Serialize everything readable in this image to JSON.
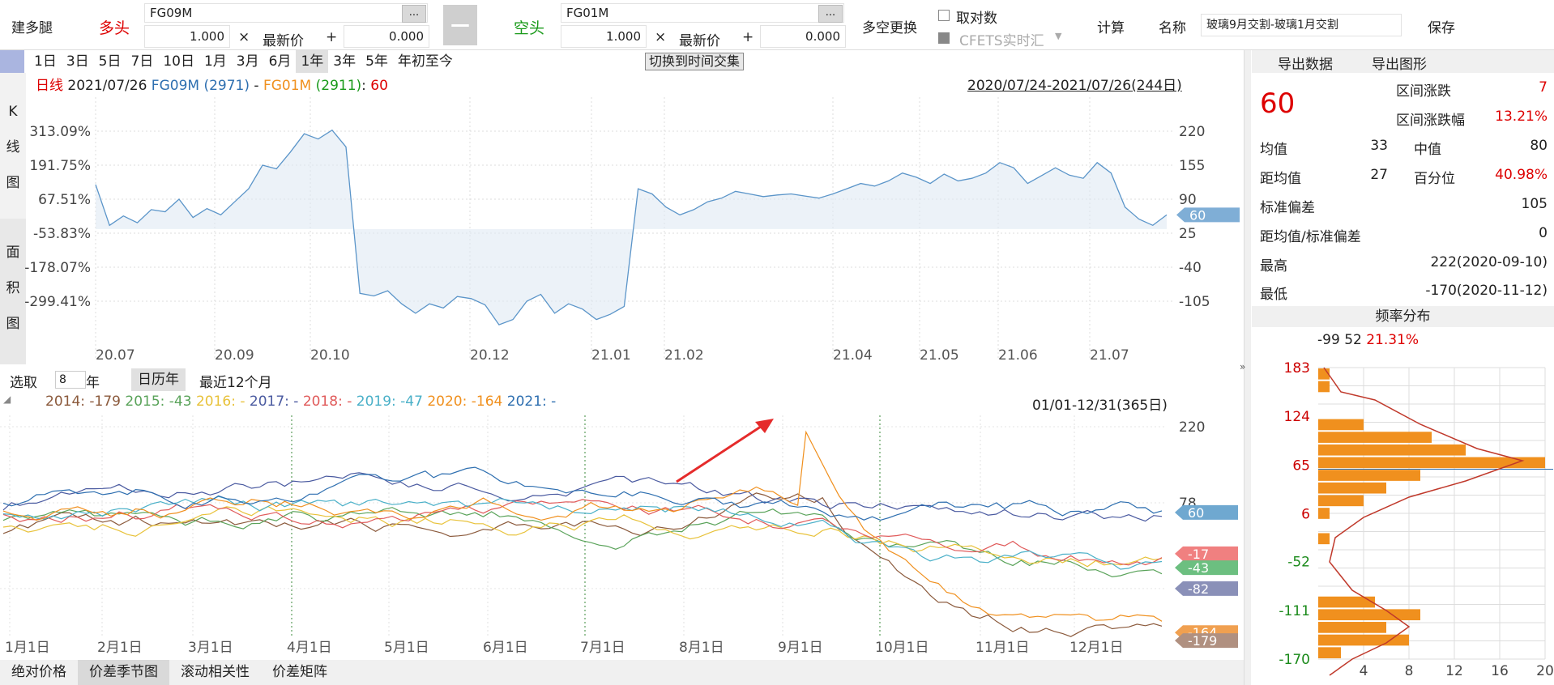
{
  "toolbar": {
    "title": "建多腿",
    "long_label": "多头",
    "short_label": "空头",
    "long_code": "FG09M",
    "short_code": "FG01M",
    "long_mult": "1.000",
    "short_mult": "1.000",
    "times": "×",
    "plus": "+",
    "latest": "最新价",
    "long_add": "0.000",
    "short_add": "0.000",
    "dots": "...",
    "minus": "—",
    "swap": "多空更换",
    "log_label": "取对数",
    "cfets": "CFETS实时汇",
    "calc": "计算",
    "name_label": "名称",
    "name_value": "玻璃9月交割-玻璃1月交割",
    "save": "保存"
  },
  "periods": [
    "1日",
    "3日",
    "5日",
    "7日",
    "10日",
    "1月",
    "3月",
    "6月",
    "1年",
    "3年",
    "5年",
    "年初至今"
  ],
  "selected_period": "1年",
  "switch_btn": "切换到时间交集",
  "upper": {
    "side_top": [
      "K",
      "线",
      "图"
    ],
    "side_bottom": [
      "面",
      "积",
      "图"
    ],
    "legend": {
      "kind": "日线",
      "date": "2021/07/26",
      "a": "FG09M",
      "a_val": "(2971)",
      "dash": "-",
      "b": "FG01M",
      "b_val": "(2911)",
      "colon": ":",
      "v": "60"
    },
    "range": "2020/07/24-2021/07/26(244日)",
    "left_ticks": [
      "313.09%",
      "191.75%",
      "67.51%",
      "-53.83%",
      "-178.07%",
      "-299.41%"
    ],
    "right_ticks": [
      "220",
      "155",
      "90",
      "25",
      "-40",
      "-105"
    ],
    "current_tag": "60",
    "x_labels": [
      "20.07",
      "20.09",
      "20.10",
      "20.12",
      "21.01",
      "21.02",
      "21.04",
      "21.05",
      "21.06",
      "21.07"
    ]
  },
  "seasonal": {
    "select_label": "选取",
    "years": "8",
    "year_unit": "年",
    "calendar_btn": "日历年",
    "rolling_btn": "最近12个月",
    "legend": [
      {
        "y": "2014:",
        "v": "-179",
        "c": "#8b5a3c"
      },
      {
        "y": "2015:",
        "v": "-43",
        "c": "#5aa35a"
      },
      {
        "y": "2016:",
        "v": "-",
        "c": "#e8c23a"
      },
      {
        "y": "2017:",
        "v": "-",
        "c": "#4a5aa0"
      },
      {
        "y": "2018:",
        "v": "-",
        "c": "#e05a5a"
      },
      {
        "y": "2019:",
        "v": "-47",
        "c": "#4ab0c8"
      },
      {
        "y": "2020:",
        "v": "-164",
        "c": "#f0901e"
      },
      {
        "y": "2021:",
        "v": "-",
        "c": "#2e6fb0"
      }
    ],
    "range": "01/01-12/31(365日)",
    "right_ticks": [
      "220",
      "78"
    ],
    "tags": [
      {
        "v": "60",
        "c": "#6fa8d0"
      },
      {
        "v": "-17",
        "c": "#f08080"
      },
      {
        "v": "-43",
        "c": "#6cbf80"
      },
      {
        "v": "-82",
        "c": "#8a90b8"
      },
      {
        "v": "-164",
        "c": "#f0a050"
      },
      {
        "v": "-179",
        "c": "#b09080"
      }
    ],
    "months": [
      "1月1日",
      "2月1日",
      "3月1日",
      "4月1日",
      "5月1日",
      "6月1日",
      "7月1日",
      "8月1日",
      "9月1日",
      "10月1日",
      "11月1日",
      "12月1日"
    ]
  },
  "tabs": [
    "绝对价格",
    "价差季节图",
    "滚动相关性",
    "价差矩阵"
  ],
  "active_tab": "价差季节图",
  "stats": {
    "export_data": "导出数据",
    "export_chart": "导出图形",
    "current": "60",
    "rows": [
      {
        "k": "区间涨跌",
        "v": "7",
        "red": true
      },
      {
        "k": "区间涨跌幅",
        "v": "13.21%",
        "red": true
      }
    ],
    "mean_label": "均值",
    "mean": "33",
    "median_label": "中值",
    "median": "80",
    "dist_label": "距均值",
    "dist": "27",
    "pct_label": "百分位",
    "pct": "40.98%",
    "std_label": "标准偏差",
    "std": "105",
    "ratio_label": "距均值/标准偏差",
    "ratio": "0",
    "high_label": "最高",
    "high": "222(2020-09-10)",
    "low_label": "最低",
    "low": "-170(2020-11-12)"
  },
  "histogram": {
    "title": "频率分布",
    "header_a": "-99",
    "header_b": "52",
    "header_c": "21.31%",
    "y_ticks": [
      "183",
      "124",
      "65",
      "6",
      "-52",
      "-111",
      "-170"
    ],
    "x_ticks": [
      "4",
      "8",
      "12",
      "16",
      "20"
    ],
    "bars": [
      1,
      1,
      0,
      0,
      4,
      10,
      13,
      20,
      9,
      6,
      4,
      1,
      0,
      1,
      0,
      0,
      0,
      0,
      5,
      9,
      6,
      8,
      2
    ]
  }
}
